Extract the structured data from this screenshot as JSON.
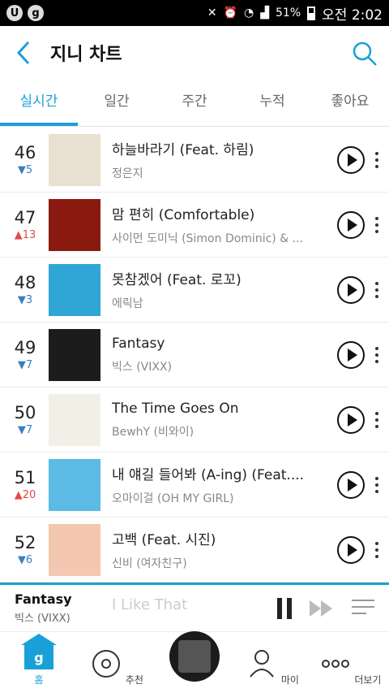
{
  "statusbar": {
    "battery": "51%",
    "time": "오전 2:02",
    "left_icons": [
      "U",
      "g"
    ]
  },
  "header": {
    "title": "지니 차트"
  },
  "tabs": [
    "실시간",
    "일간",
    "주간",
    "누적",
    "좋아요"
  ],
  "active_tab": "실시간",
  "chart": [
    {
      "rank": "46",
      "change": "▼5",
      "direction": "down",
      "title": "하늘바라기 (Feat. 하림)",
      "artist": "정은지",
      "cover_color": "#e8e0d0"
    },
    {
      "rank": "47",
      "change": "▲13",
      "direction": "up",
      "title": "맘 편히 (Comfortable)",
      "artist": "사이먼 도미닉 (Simon Dominic) & ...",
      "cover_color": "#8a1a10"
    },
    {
      "rank": "48",
      "change": "▼3",
      "direction": "down",
      "title": "못참겠어 (Feat. 로꼬)",
      "artist": "에릭남",
      "cover_color": "#2fa6d6"
    },
    {
      "rank": "49",
      "change": "▼7",
      "direction": "down",
      "title": "Fantasy",
      "artist": "빅스 (VIXX)",
      "cover_color": "#1c1c1c"
    },
    {
      "rank": "50",
      "change": "▼7",
      "direction": "down",
      "title": "The Time Goes On",
      "artist": "BewhY (비와이)",
      "cover_color": "#f2f0e6"
    },
    {
      "rank": "51",
      "change": "▲20",
      "direction": "up",
      "title": "내 얘길 들어봐 (A-ing) (Feat....",
      "artist": "오마이걸 (OH MY GIRL)",
      "cover_color": "#5bbbe4"
    },
    {
      "rank": "52",
      "change": "▼6",
      "direction": "down",
      "title": "고백 (Feat. 시진)",
      "artist": "신비 (여자친구)",
      "cover_color": "#f4c7b0"
    }
  ],
  "player": {
    "title": "Fantasy",
    "artist": "빅스 (VIXX)",
    "ghost_text": "I Like That"
  },
  "bottom_nav": [
    {
      "label": "홈"
    },
    {
      "label": "추천"
    },
    {
      "label": ""
    },
    {
      "label": "마이"
    },
    {
      "label": "더보기"
    }
  ],
  "colors": {
    "accent": "#1aa0d8",
    "up": "#e04b4b",
    "down": "#3a7fc0"
  }
}
